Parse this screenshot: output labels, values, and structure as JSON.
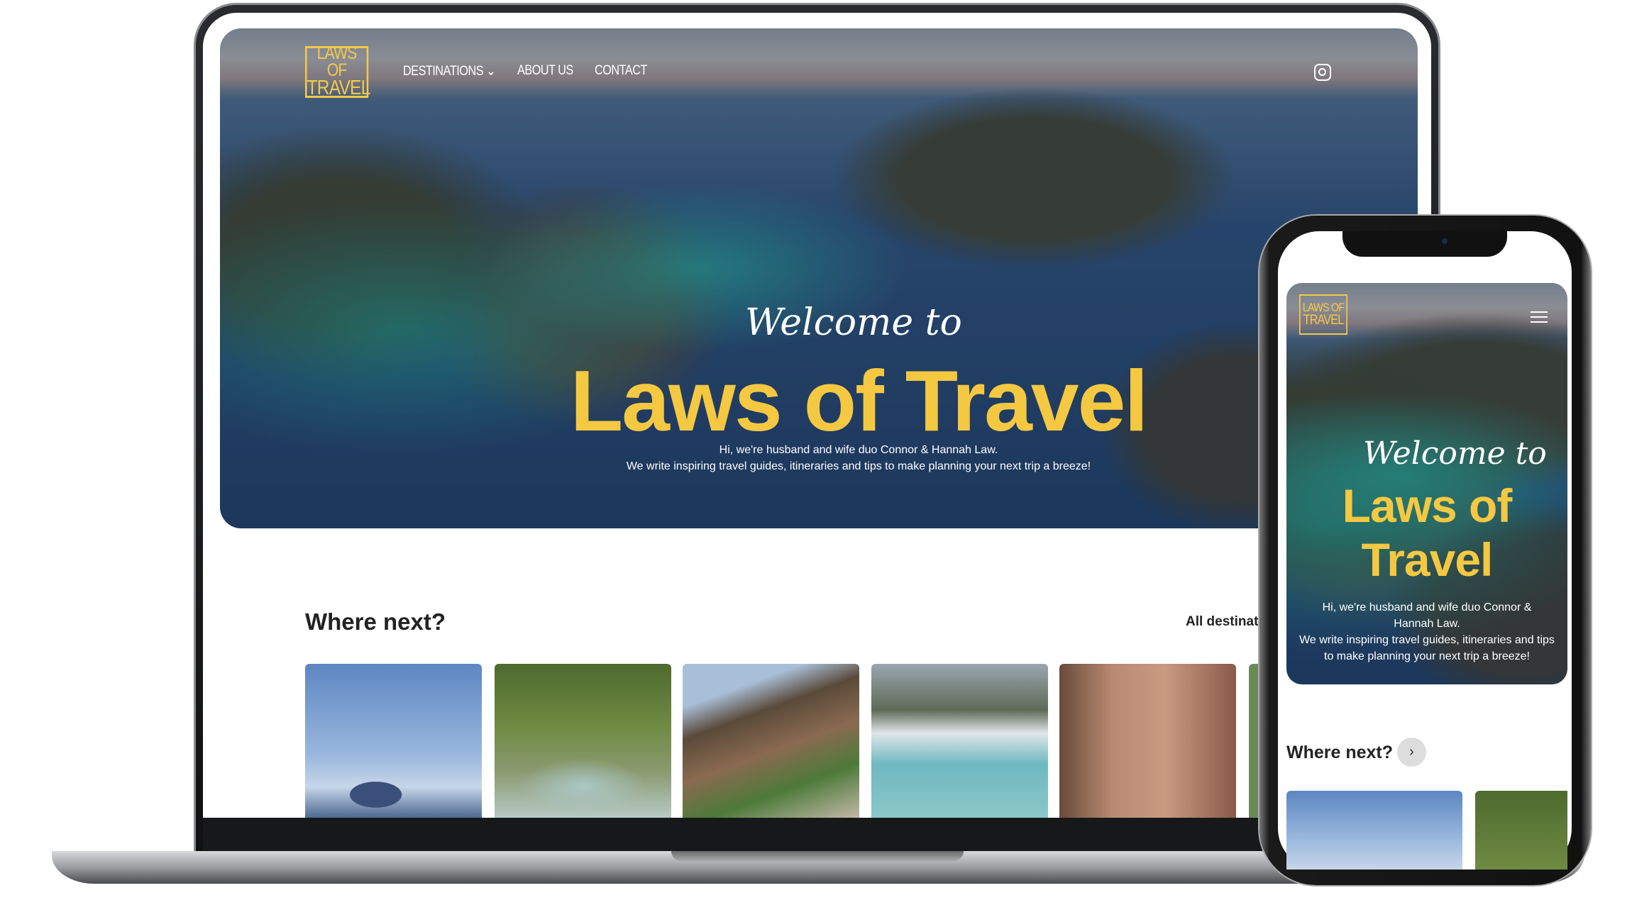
{
  "desktop": {
    "logo": {
      "line1": "LAWS OF",
      "line2": "TRAVEL"
    },
    "nav": [
      {
        "label": "DESTINATIONS",
        "icon": "chevron-down-icon"
      },
      {
        "label": "ABOUT US"
      },
      {
        "label": "CONTACT"
      }
    ],
    "social_icon": "instagram-icon",
    "hero": {
      "script": "Welcome to",
      "title": "Laws of Travel",
      "subtitle_line1": "Hi, we're husband and wife duo Connor & Hannah Law.",
      "subtitle_line2": "We write inspiring travel guides, itineraries and tips to make planning your next trip a breeze!"
    },
    "section": {
      "title": "Where next?",
      "link": "All destinati"
    },
    "cards": [
      "mount-fuji",
      "waterfall-jungle",
      "korean-temple",
      "lake-louise",
      "petra-treasury"
    ]
  },
  "mobile": {
    "logo": {
      "line1": "LAWS OF",
      "line2": "TRAVEL"
    },
    "menu_icon": "hamburger-icon",
    "hero": {
      "script": "Welcome to",
      "title_line1": "Laws of",
      "title_line2": "Travel",
      "para1": "Hi, we're husband and wife duo Connor & Hannah Law.",
      "para2": "We write inspiring travel guides, itineraries and tips to make planning your next trip a breeze!"
    },
    "section": {
      "title": "Where next?",
      "button_icon": "chevron-right-icon"
    }
  },
  "colors": {
    "accent": "#f5c842",
    "text": "#222222"
  }
}
